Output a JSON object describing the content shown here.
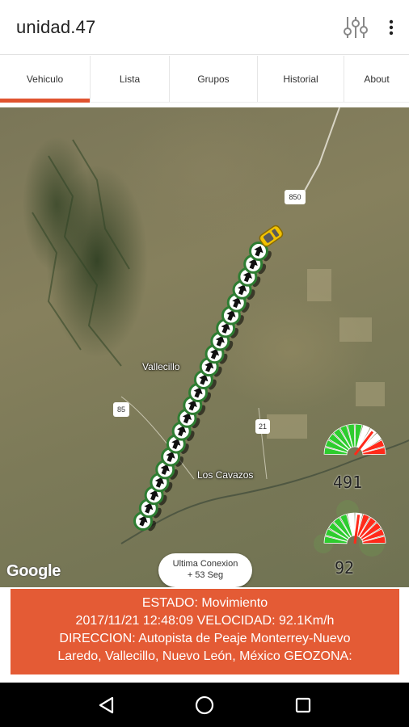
{
  "app": {
    "title": "unidad.47"
  },
  "toolbar": {
    "filter_icon": "sliders-icon",
    "more_icon": "more-vert-icon"
  },
  "tabs": [
    {
      "label": "Vehiculo",
      "active": true
    },
    {
      "label": "Lista",
      "active": false
    },
    {
      "label": "Grupos",
      "active": false
    },
    {
      "label": "Historial",
      "active": false
    },
    {
      "label": "About",
      "active": false
    }
  ],
  "map": {
    "places": {
      "town1": "Vallecillo",
      "town2": "Los Cavazos"
    },
    "route_shields": {
      "r1": "850",
      "r2": "85",
      "r3": "21"
    },
    "attribution": "Google",
    "connection": {
      "line1": "Ultima Conexion",
      "line2": "+ 53 Seg"
    },
    "gauges": {
      "upper_value": "491",
      "lower_value": "92"
    },
    "colors": {
      "route": "#2e7d32",
      "vehicle": "#f2c200"
    }
  },
  "status": {
    "line1": "ESTADO: Movimiento",
    "line2": "2017/11/21 12:48:09 VELOCIDAD: 92.1Km/h",
    "line3": "DIRECCION: Autopista de Peaje Monterrey-Nuevo",
    "line4": "Laredo, Vallecillo, Nuevo León, México GEOZONA:"
  },
  "colors": {
    "accent": "#e0532f",
    "status_bg": "#e45b35"
  },
  "navbar": {
    "back_icon": "back-icon",
    "home_icon": "home-icon",
    "recents_icon": "recents-icon"
  }
}
